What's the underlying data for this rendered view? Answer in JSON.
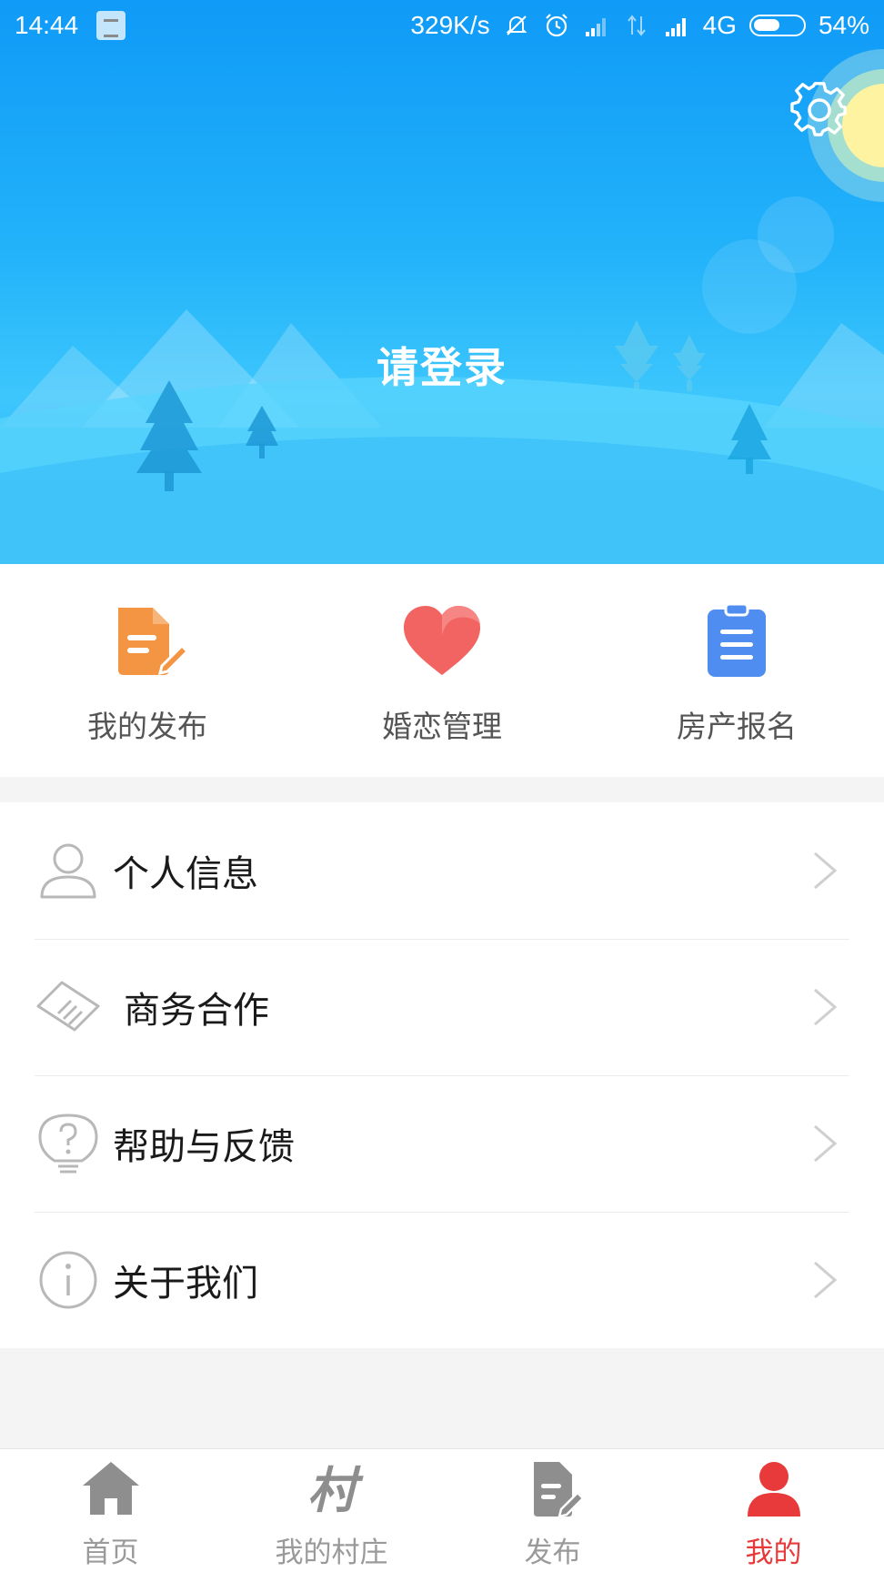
{
  "status_bar": {
    "time": "14:44",
    "network_speed": "329K/s",
    "network_type": "4G",
    "battery_percent": "54%",
    "battery_level": 0.54,
    "icons": [
      "notification-app-icon",
      "mute-icon",
      "alarm-icon",
      "signal-icon",
      "data-transfer-icon",
      "signal-icon",
      "battery-icon"
    ]
  },
  "header": {
    "login_prompt": "请登录",
    "settings_icon": "gear-icon"
  },
  "quick_actions": [
    {
      "label": "我的发布",
      "icon": "document-edit-icon",
      "color": "#f49544"
    },
    {
      "label": "婚恋管理",
      "icon": "heart-icon",
      "color": "#f26461"
    },
    {
      "label": "房产报名",
      "icon": "clipboard-list-icon",
      "color": "#4f8ef0"
    }
  ],
  "menu": [
    {
      "label": "个人信息",
      "icon": "user-icon"
    },
    {
      "label": "商务合作",
      "icon": "handshake-icon"
    },
    {
      "label": "帮助与反馈",
      "icon": "help-icon"
    },
    {
      "label": "关于我们",
      "icon": "info-icon"
    }
  ],
  "bottom_nav": [
    {
      "label": "首页",
      "icon": "home-icon",
      "active": false
    },
    {
      "label": "我的村庄",
      "icon": "village-icon",
      "active": false
    },
    {
      "label": "发布",
      "icon": "publish-icon",
      "active": false
    },
    {
      "label": "我的",
      "icon": "profile-icon",
      "active": true
    }
  ],
  "colors": {
    "active_nav": "#e83a3a",
    "inactive_nav": "#9a9a9a",
    "banner_blue": "#0f9af7"
  },
  "village_glyph": "村"
}
